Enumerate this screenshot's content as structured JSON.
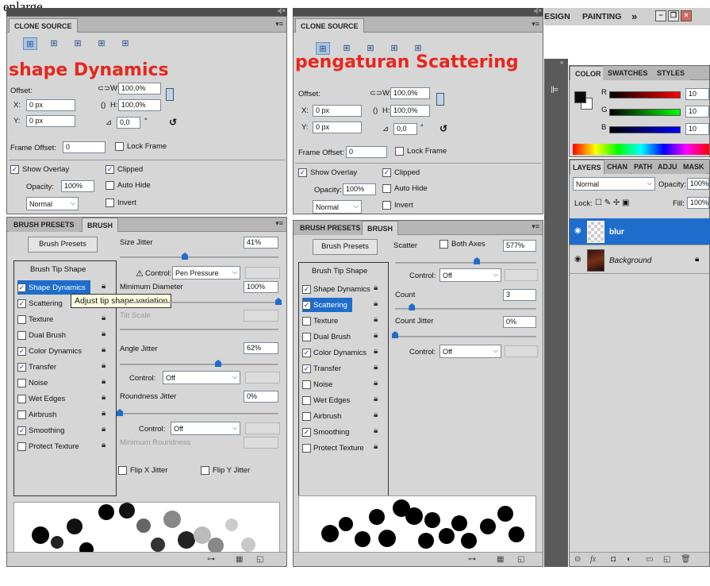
{
  "caption": "enlarge",
  "left": {
    "clone_tab": "CLONE SOURCE",
    "dock_icons": "«| ×",
    "menu_icon": "▾≡",
    "overlay": "shape Dynamics",
    "offset_label": "Offset:",
    "w_label": "W:",
    "w_value": "100,0%",
    "h_label": "H:",
    "h_value": "100,0%",
    "x_label": "X:",
    "x_value": "0 px",
    "y_label": "Y:",
    "y_value": "0 px",
    "angle_value": "0,0",
    "angle_unit": "°",
    "frame_offset_label": "Frame Offset:",
    "frame_offset_value": "0",
    "lock_frame": "Lock Frame",
    "show_overlay": "Show Overlay",
    "clipped": "Clipped",
    "opacity_label": "Opacity:",
    "opacity_value": "100%",
    "auto_hide": "Auto Hide",
    "blend_mode": "Normal",
    "invert": "Invert",
    "brush_tabs": [
      "BRUSH PRESETS",
      "BRUSH"
    ],
    "brush_presets_btn": "Brush Presets",
    "tip_shape_header": "Brush Tip Shape",
    "items": [
      {
        "label": "Shape Dynamics",
        "checked": true,
        "hl": true
      },
      {
        "label": "Scattering",
        "checked": true,
        "hl": false
      },
      {
        "label": "Texture",
        "checked": false,
        "hl": false
      },
      {
        "label": "Dual Brush",
        "checked": false,
        "hl": false
      },
      {
        "label": "Color Dynamics",
        "checked": true,
        "hl": false
      },
      {
        "label": "Transfer",
        "checked": true,
        "hl": false
      },
      {
        "label": "Noise",
        "checked": false,
        "hl": false
      },
      {
        "label": "Wet Edges",
        "checked": false,
        "hl": false
      },
      {
        "label": "Airbrush",
        "checked": false,
        "hl": false
      },
      {
        "label": "Smoothing",
        "checked": true,
        "hl": false
      },
      {
        "label": "Protect Texture",
        "checked": false,
        "hl": false
      }
    ],
    "tooltip": "Adjust tip shape variation",
    "size_jitter": "Size Jitter",
    "size_jitter_value": "41%",
    "size_jitter_level": 0.41,
    "control_label": "Control:",
    "control_value": "Pen Pressure",
    "min_diameter": "Minimum Diameter",
    "min_diameter_value": "100%",
    "min_diameter_level": 1.0,
    "tilt_scale": "Tilt Scale",
    "angle_jitter": "Angle Jitter",
    "angle_jitter_value": "62%",
    "angle_jitter_level": 0.62,
    "angle_control": "Off",
    "roundness_jitter": "Roundness Jitter",
    "roundness_jitter_value": "0%",
    "roundness_jitter_level": 0,
    "roundness_control": "Off",
    "min_roundness": "Minimum Roundness",
    "flip_x": "Flip X Jitter",
    "flip_y": "Flip Y Jitter"
  },
  "right": {
    "clone_tab": "CLONE SOURCE",
    "overlay": "pengaturan Scattering",
    "scatter": "Scatter",
    "both_axes": "Both Axes",
    "scatter_value": "577%",
    "scatter_level": 0.58,
    "control_label": "Control:",
    "control_value": "Off",
    "count": "Count",
    "count_value": "3",
    "count_level": 0.12,
    "count_jitter": "Count Jitter",
    "count_jitter_value": "0%",
    "count_jitter_level": 0,
    "count_control": "Off",
    "items": [
      {
        "label": "Shape Dynamics",
        "checked": true,
        "hl": false
      },
      {
        "label": "Scattering",
        "checked": true,
        "hl": true
      },
      {
        "label": "Texture",
        "checked": false,
        "hl": false
      },
      {
        "label": "Dual Brush",
        "checked": false,
        "hl": false
      },
      {
        "label": "Color Dynamics",
        "checked": true,
        "hl": false
      },
      {
        "label": "Transfer",
        "checked": true,
        "hl": false
      },
      {
        "label": "Noise",
        "checked": false,
        "hl": false
      },
      {
        "label": "Wet Edges",
        "checked": false,
        "hl": false
      },
      {
        "label": "Airbrush",
        "checked": false,
        "hl": false
      },
      {
        "label": "Smoothing",
        "checked": true,
        "hl": false
      },
      {
        "label": "Protect Texture",
        "checked": false,
        "hl": false
      }
    ]
  },
  "menubar": {
    "design": "ESIGN",
    "painting": "PAINTING",
    "more": "»"
  },
  "color_panel": {
    "tabs": [
      "COLOR",
      "SWATCHES",
      "STYLES"
    ],
    "r_label": "R",
    "r_value": "10",
    "g_label": "G",
    "g_value": "10",
    "b_label": "B",
    "b_value": "10",
    "foreground": "#0a0a0a"
  },
  "layers_panel": {
    "tabs": [
      "LAYERS",
      "CHAN",
      "PATH",
      "ADJU",
      "MASK"
    ],
    "mode": "Normal",
    "opacity_label": "Opacity:",
    "opacity_value": "100%",
    "lock_label": "Lock:",
    "fill_label": "Fill:",
    "fill_value": "100%",
    "layers": [
      {
        "name": "blur",
        "selected": true
      },
      {
        "name": "Background",
        "selected": false
      }
    ]
  },
  "colors": {
    "accent": "#1e6dcc",
    "overlay_text": "#e8261c",
    "panel_bg": "#d6d6d6"
  }
}
